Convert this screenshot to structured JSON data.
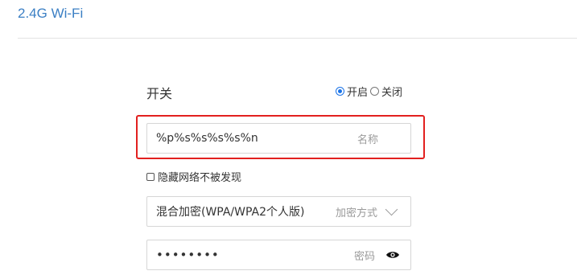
{
  "header": {
    "title": "2.4G Wi-Fi"
  },
  "switch": {
    "label": "开关",
    "options": [
      {
        "label": "开启",
        "selected": true
      },
      {
        "label": "关闭",
        "selected": false
      }
    ]
  },
  "ssid": {
    "value": "%p%s%s%s%s%n",
    "hint": "名称"
  },
  "hide_network": {
    "label": "隐藏网络不被发现",
    "checked": false
  },
  "encryption": {
    "value": "混合加密(WPA/WPA2个人版)",
    "hint": "加密方式",
    "icon": "chevron-down-icon"
  },
  "password": {
    "value": "••••••••",
    "hint": "密码",
    "icon": "eye-icon"
  },
  "colors": {
    "accent": "#3b7fc4",
    "highlight": "#e2201f",
    "radio": "#1a73e8"
  }
}
